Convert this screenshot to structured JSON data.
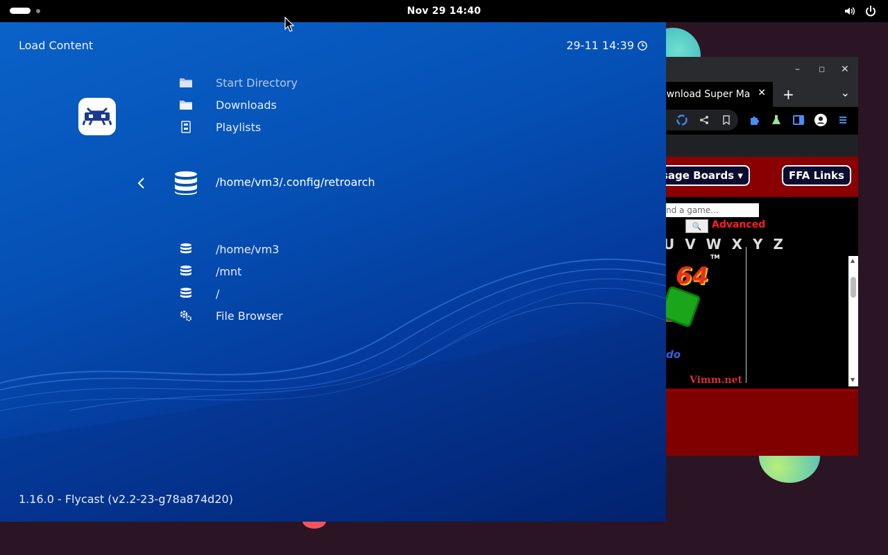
{
  "topbar": {
    "clock": "Nov 29  14:40"
  },
  "retroarch": {
    "title": "Load Content",
    "datetime": "29-11 14:39",
    "version": "1.16.0 - Flycast (v2.2-23-g78a874d20)",
    "menu_top": [
      {
        "label": "Start Directory",
        "icon": "folder-icon"
      },
      {
        "label": "Downloads",
        "icon": "folder-icon"
      },
      {
        "label": "Playlists",
        "icon": "playlist-icon"
      }
    ],
    "selected": {
      "label": "/home/vm3/.config/retroarch",
      "icon": "database-icon"
    },
    "menu_bottom": [
      {
        "label": "/home/vm3",
        "icon": "database-icon"
      },
      {
        "label": "/mnt",
        "icon": "database-icon"
      },
      {
        "label": "/",
        "icon": "database-icon"
      },
      {
        "label": "File Browser",
        "icon": "settings-icon"
      }
    ]
  },
  "browser": {
    "tab_title": "ownload Super Ma",
    "nav_buttons": [
      "sage Boards ▾",
      "FFA Links"
    ],
    "search_placeholder": "nd a game...",
    "search_button": "🔍",
    "advanced": "Advanced",
    "letters": "U V W X Y Z",
    "tm": "TM",
    "n64": "64",
    "do_text": "do",
    "vimm": "Vimm.net"
  }
}
